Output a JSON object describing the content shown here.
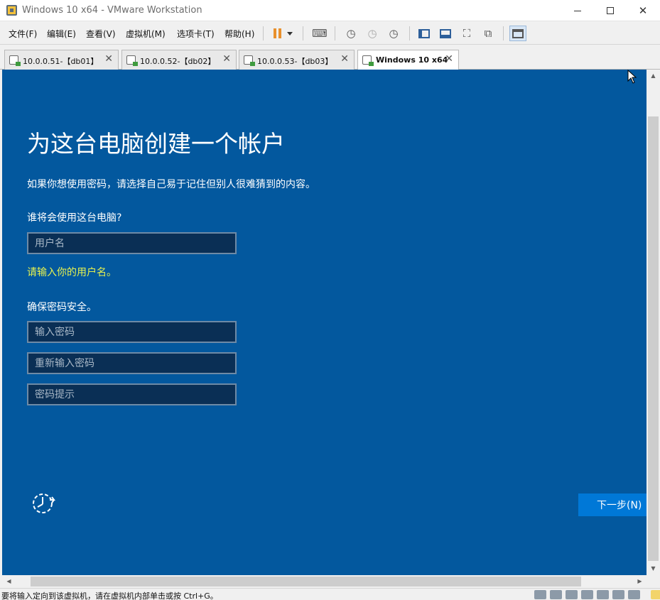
{
  "window": {
    "title": "Windows 10 x64 - VMware Workstation",
    "minimize_symbol": "—",
    "maximize_symbol": "☐",
    "close_symbol": "✕"
  },
  "menu": {
    "items": [
      "文件(F)",
      "编辑(E)",
      "查看(V)",
      "虚拟机(M)",
      "选项卡(T)",
      "帮助(H)"
    ]
  },
  "toolbar": {
    "icons": [
      "pause-icon",
      "dropdown-icon",
      "send-ctrl-alt-del-icon",
      "snapshot-take-icon",
      "snapshot-revert-icon",
      "snapshot-manager-icon",
      "sidebar-view-icon",
      "thumbnail-bar-icon",
      "full-screen-icon",
      "unity-icon",
      "console-view-icon"
    ]
  },
  "tabs": [
    {
      "label": "10.0.0.51-【db01】",
      "selected": false
    },
    {
      "label": "10.0.0.52-【db02】",
      "selected": false
    },
    {
      "label": "10.0.0.53-【db03】",
      "selected": false
    },
    {
      "label": "Windows 10 x64",
      "selected": true
    }
  ],
  "tab_close_symbol": "✕",
  "vm": {
    "title": "为这台电脑创建一个帐户",
    "subtitle": "如果你想使用密码，请选择自己易于记住但别人很难猜到的内容。",
    "who_label": "谁将会使用这台电脑?",
    "username_placeholder": "用户名",
    "username_error": "请输入你的用户名。",
    "password_label": "确保密码安全。",
    "password_placeholder": "输入密码",
    "confirm_placeholder": "重新输入密码",
    "hint_placeholder": "密码提示",
    "next_label": "下一步(N)",
    "accent": "#0078d7",
    "background": "#03589e"
  },
  "scroll": {
    "up_arrow": "▲",
    "down_arrow": "▼",
    "left_arrow": "◀",
    "right_arrow": "▶"
  },
  "status": {
    "text": "要将输入定向到该虚拟机，请在虚拟机内部单击或按 Ctrl+G。"
  }
}
